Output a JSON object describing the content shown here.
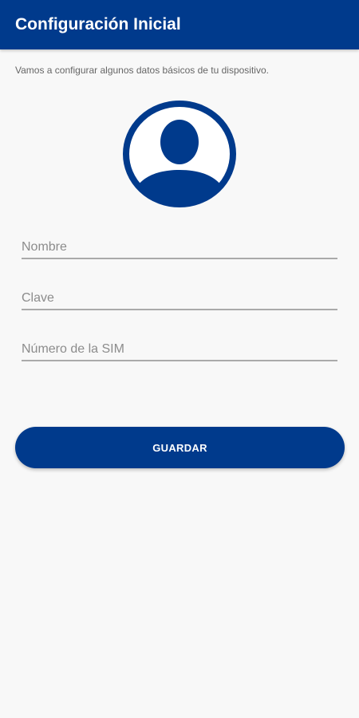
{
  "app_bar": {
    "title": "Configuración Inicial",
    "background_color": "#003a8c"
  },
  "intro": {
    "text": "Vamos a configurar algunos datos básicos de tu dispositivo."
  },
  "avatar": {
    "icon": "user-avatar-icon",
    "color": "#003a8c"
  },
  "form": {
    "name_placeholder": "Nombre",
    "name_value": "",
    "key_placeholder": "Clave",
    "key_value": "",
    "sim_placeholder": "Número de la SIM",
    "sim_value": ""
  },
  "actions": {
    "save_label": "GUARDAR",
    "button_color": "#003a8c"
  }
}
